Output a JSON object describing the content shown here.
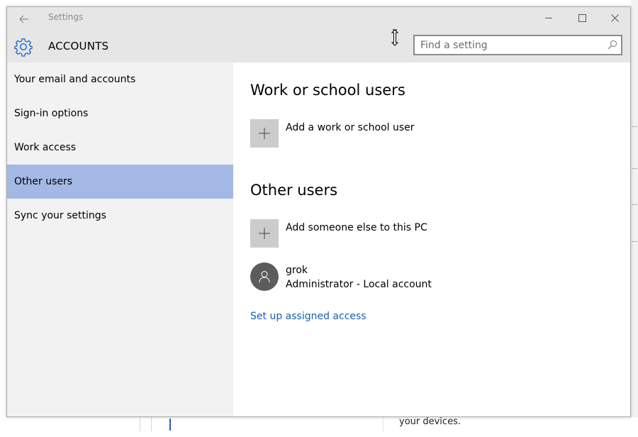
{
  "window": {
    "app_title": "Settings",
    "section_title": "ACCOUNTS",
    "controls": [
      "minimize-icon",
      "maximize-icon",
      "close-icon"
    ]
  },
  "search": {
    "placeholder": "Find a setting",
    "value": ""
  },
  "sidebar": {
    "items": [
      {
        "label": "Your email and accounts",
        "selected": false
      },
      {
        "label": "Sign-in options",
        "selected": false
      },
      {
        "label": "Work access",
        "selected": false
      },
      {
        "label": "Other users",
        "selected": true
      },
      {
        "label": "Sync your settings",
        "selected": false
      }
    ]
  },
  "main": {
    "work_heading": "Work or school users",
    "add_work_label": "Add a work or school user",
    "other_heading": "Other users",
    "add_other_label": "Add someone else to this PC",
    "user": {
      "name": "grok",
      "role": "Administrator - Local account"
    },
    "assigned_access_link": "Set up assigned access"
  },
  "background": {
    "fragment_text": "your devices."
  },
  "colors": {
    "titlebar": "#e6e6e6",
    "sidebar": "#f2f2f2",
    "selected": "#a3b8e4",
    "tile": "#cccccc",
    "avatar": "#5c5c5c",
    "link": "#1a5fb4",
    "accent_icon": "#1c64c8"
  }
}
